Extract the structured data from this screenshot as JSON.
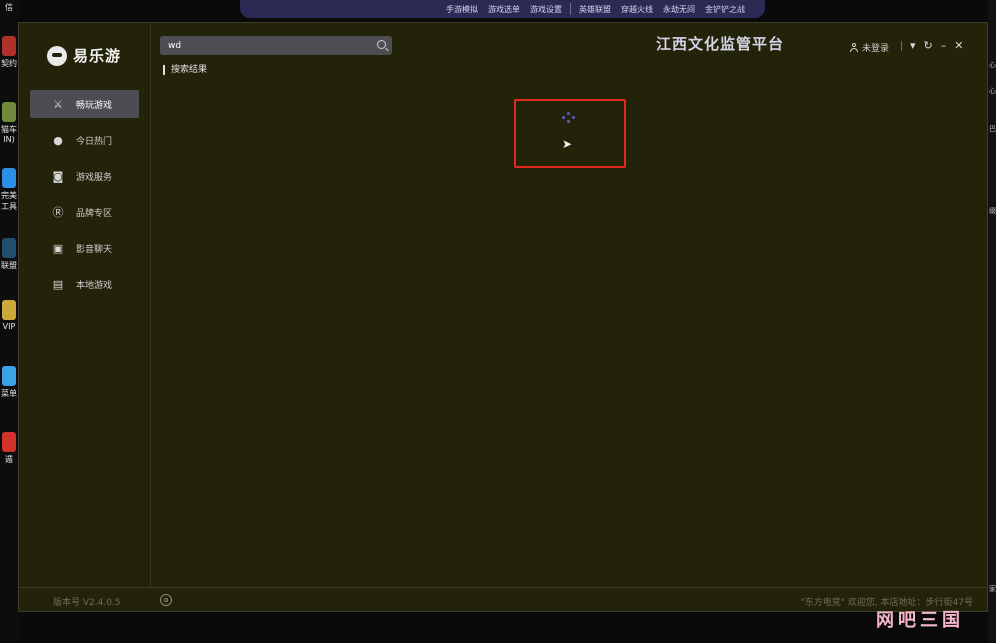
{
  "taskbar": {
    "group1": [
      "手游模拟",
      "游戏选单",
      "游戏设置"
    ],
    "group2": [
      "英雄联盟",
      "穿越火线",
      "永劫无间",
      "金铲铲之战"
    ]
  },
  "desktop_left": {
    "items": [
      "信",
      "契约",
      "猫车",
      "IN)",
      "完美",
      "工具",
      "联盟",
      "VIP",
      "菜单",
      "遁"
    ]
  },
  "desktop_right": {
    "items": [
      "心",
      "心",
      "巴",
      "缀",
      "家"
    ]
  },
  "app": {
    "logo_text": "易乐游",
    "nav": [
      {
        "label": "畅玩游戏",
        "icon": "crossed-swords-icon",
        "active": true
      },
      {
        "label": "今日热门",
        "icon": "fire-icon",
        "active": false
      },
      {
        "label": "游戏服务",
        "icon": "gamepad-icon",
        "active": false
      },
      {
        "label": "品牌专区",
        "icon": "brand-r-icon",
        "active": false
      },
      {
        "label": "影音聊天",
        "icon": "chat-video-icon",
        "active": false
      },
      {
        "label": "本地游戏",
        "icon": "folder-game-icon",
        "active": false
      }
    ],
    "version": "版本号 V2.4.0.5",
    "footer_right": "\"东方电竞\" 欢迎您, 本店地址：步行街47号"
  },
  "header": {
    "platform_title": "江西文化监管平台",
    "login_label": "未登录"
  },
  "search": {
    "value": "wd",
    "result_label": "搜索结果"
  },
  "watermark": "网吧三国",
  "colors": {
    "window_bg": "#232309",
    "active_nav": "#4c4c52",
    "highlight_box": "#e3261e",
    "spinner": "#5b5bd8"
  }
}
